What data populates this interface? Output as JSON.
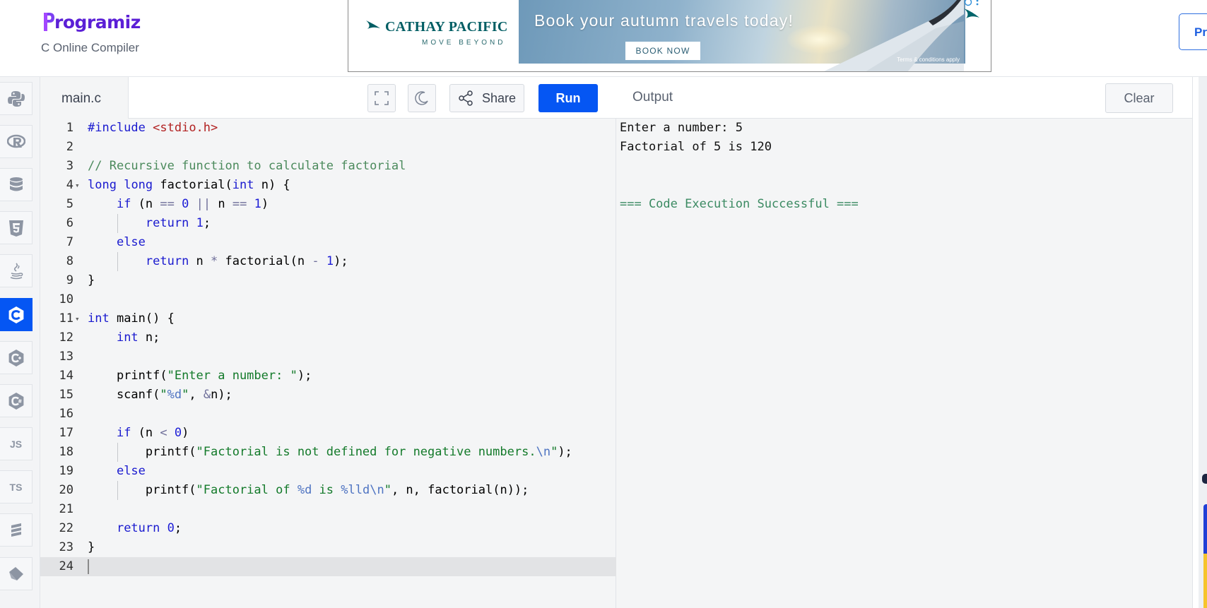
{
  "header": {
    "logo_text": "rogramiz",
    "logo_letter": "P",
    "subtitle": "C Online Compiler",
    "pro_button_label": "Pr"
  },
  "ad": {
    "brand": "CATHAY PACIFIC",
    "tagline": "MOVE BEYOND",
    "headline": "Book your autumn travels today!",
    "cta": "BOOK NOW",
    "terms": "Terms & conditions apply"
  },
  "languages": [
    {
      "name": "python-icon",
      "label": ""
    },
    {
      "name": "r-icon",
      "label": ""
    },
    {
      "name": "sql-icon",
      "label": ""
    },
    {
      "name": "html5-icon",
      "label": ""
    },
    {
      "name": "java-icon",
      "label": ""
    },
    {
      "name": "c-icon",
      "label": "",
      "active": true
    },
    {
      "name": "cpp-icon",
      "label": ""
    },
    {
      "name": "csharp-icon",
      "label": ""
    },
    {
      "name": "javascript-icon",
      "label": "JS"
    },
    {
      "name": "typescript-icon",
      "label": "TS"
    },
    {
      "name": "go-icon",
      "label": ""
    },
    {
      "name": "swift-icon",
      "label": ""
    }
  ],
  "editor": {
    "file_tab": "main.c",
    "share_label": "Share",
    "run_label": "Run",
    "line_numbers": [
      "1",
      "2",
      "3",
      "4",
      "5",
      "6",
      "7",
      "8",
      "9",
      "10",
      "11",
      "12",
      "13",
      "14",
      "15",
      "16",
      "17",
      "18",
      "19",
      "20",
      "21",
      "22",
      "23",
      "24"
    ],
    "current_line": 24
  },
  "output": {
    "title": "Output",
    "clear_label": "Clear",
    "lines": [
      "Enter a number: 5",
      "Factorial of 5 is 120",
      "",
      "",
      "=== Code Execution Successful ==="
    ]
  },
  "colors": {
    "accent": "#0556f3",
    "brand_purple": "#5b1fd6",
    "success": "#3b8a62"
  }
}
